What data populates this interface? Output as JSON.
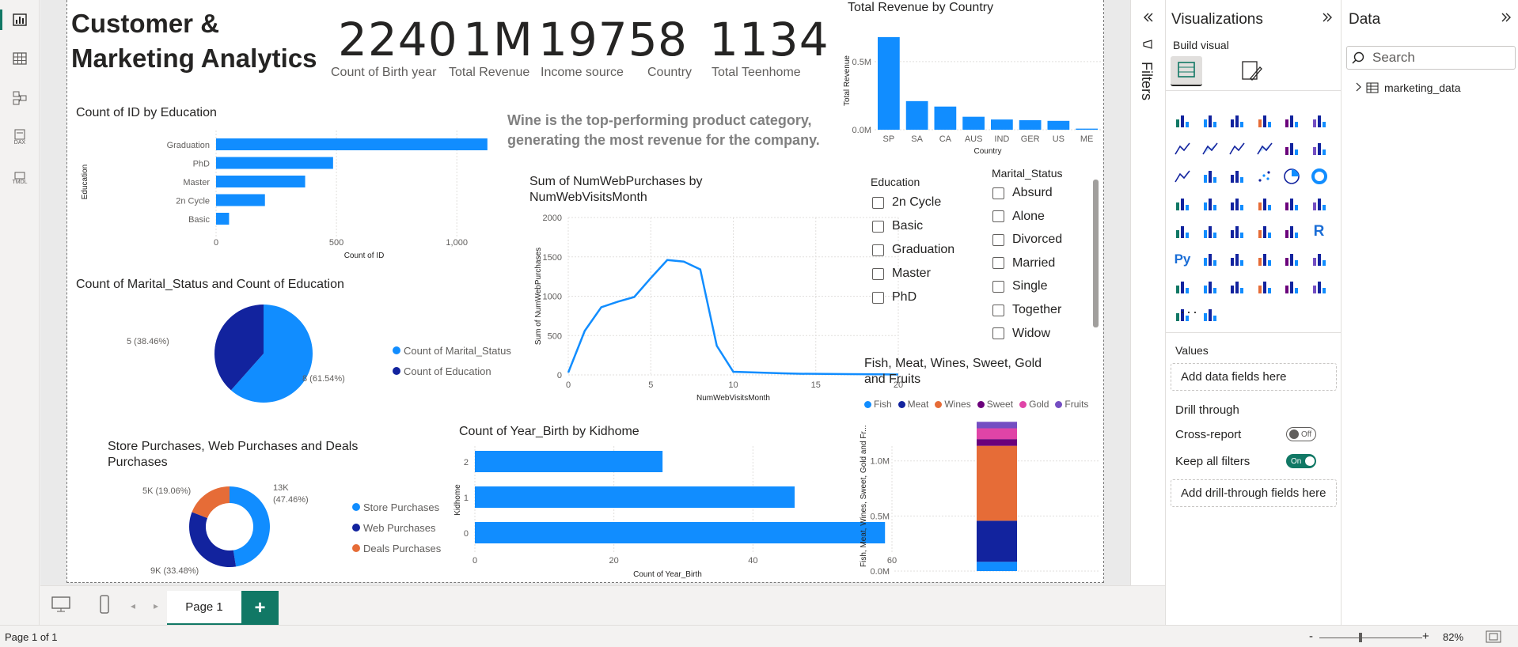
{
  "rail": {
    "items": [
      "report-view",
      "table-view",
      "model-view",
      "dax-query-view",
      "tmdl-view"
    ],
    "dax_label": "DAX",
    "tmdl_label": "TMDL"
  },
  "report": {
    "title_line1": "Customer &",
    "title_line2": "Marketing Analytics",
    "kpis": [
      {
        "value": "2240",
        "label": "Count of Birth year"
      },
      {
        "value": "1M",
        "label": "Total Revenue"
      },
      {
        "value": "1975",
        "label": "Income source"
      },
      {
        "value": "8",
        "label": "Country"
      },
      {
        "value": "1134",
        "label": "Total Teenhome"
      }
    ],
    "insight_line1": "Wine is the top-performing product category,",
    "insight_line2": "generating the most revenue for the company."
  },
  "colors": {
    "blue": "#118dff",
    "navy": "#12239e",
    "orange": "#e66c37",
    "purple": "#6b007b",
    "pink": "#e044a7",
    "violet": "#744ec2",
    "accent": "#117865"
  },
  "chart_data": [
    {
      "id": "revenue-by-country",
      "type": "bar",
      "title": "Total Revenue by Country",
      "xlabel": "Country",
      "ylabel": "Total Revenue",
      "categories": [
        "SP",
        "SA",
        "CA",
        "AUS",
        "IND",
        "GER",
        "US",
        "ME"
      ],
      "values": [
        680000,
        210000,
        170000,
        95000,
        75000,
        70000,
        65000,
        8000
      ],
      "yticks": [
        "0.0M",
        "0.5M"
      ],
      "ylim": [
        0,
        720000
      ]
    },
    {
      "id": "id-by-education",
      "type": "bar",
      "orientation": "horizontal",
      "title": "Count of ID by Education",
      "xlabel": "Count of ID",
      "ylabel": "Education",
      "categories": [
        "Graduation",
        "PhD",
        "Master",
        "2n Cycle",
        "Basic"
      ],
      "values": [
        1127,
        486,
        370,
        203,
        54
      ],
      "xticks": [
        "0",
        "500",
        "1,000"
      ],
      "xlim": [
        0,
        1200
      ]
    },
    {
      "id": "marital-education-pie",
      "type": "pie",
      "title": "Count of Marital_Status and Count of Education",
      "series": [
        {
          "name": "Count of Marital_Status",
          "value": 8,
          "label": "8 (61.54%)"
        },
        {
          "name": "Count of Education",
          "value": 5,
          "label": "5 (38.46%)"
        }
      ]
    },
    {
      "id": "purchases-donut",
      "type": "pie",
      "title": "Store Purchases, Web Purchases and Deals Purchases",
      "series": [
        {
          "name": "Store Purchases",
          "value": 47.46,
          "label_a": "13K",
          "label_b": "(47.46%)"
        },
        {
          "name": "Web Purchases",
          "value": 33.48,
          "label": "9K (33.48%)"
        },
        {
          "name": "Deals Purchases",
          "value": 19.06,
          "label": "5K (19.06%)"
        }
      ]
    },
    {
      "id": "web-purchases-line",
      "type": "line",
      "title_line1": "Sum of NumWebPurchases by",
      "title_line2": "NumWebVisitsMonth",
      "xlabel": "NumWebVisitsMonth",
      "ylabel": "Sum of NumWebPurchases",
      "x": [
        0,
        1,
        2,
        3,
        4,
        5,
        6,
        7,
        8,
        9,
        10,
        13,
        14,
        17,
        19,
        20
      ],
      "y": [
        30,
        560,
        860,
        930,
        990,
        1230,
        1460,
        1440,
        1340,
        370,
        40,
        20,
        15,
        10,
        8,
        5
      ],
      "xticks": [
        "0",
        "5",
        "10",
        "15",
        "20"
      ],
      "yticks": [
        "0",
        "500",
        "1000",
        "1500",
        "2000"
      ],
      "xlim": [
        0,
        20
      ],
      "ylim": [
        0,
        2000
      ]
    },
    {
      "id": "yearbirth-by-kidhome",
      "type": "bar",
      "orientation": "horizontal",
      "title": "Count of Year_Birth by Kidhome",
      "xlabel": "Count of Year_Birth",
      "ylabel": "Kidhome",
      "categories": [
        "2",
        "1",
        "0"
      ],
      "values": [
        27,
        46,
        59
      ],
      "xticks": [
        "0",
        "20",
        "40",
        "60"
      ],
      "xlim": [
        0,
        60
      ]
    },
    {
      "id": "product-stacked",
      "type": "bar",
      "stacked": true,
      "title_line1": "Fish, Meat, Wines, Sweet, Gold",
      "title_line2": "and Fruits",
      "ylabel": "Fish, Meat, Wines, Sweet, Gold and Fr...",
      "yticks": [
        "0.0M",
        "0.5M",
        "1.0M"
      ],
      "ylim": [
        0,
        1350000
      ],
      "series": [
        {
          "name": "Fish",
          "value": 84000
        },
        {
          "name": "Meat",
          "value": 373000
        },
        {
          "name": "Wines",
          "value": 680000
        },
        {
          "name": "Sweet",
          "value": 61000
        },
        {
          "name": "Gold",
          "value": 98000
        },
        {
          "name": "Fruits",
          "value": 59000
        }
      ]
    }
  ],
  "slicers": {
    "education": {
      "title": "Education",
      "items": [
        "2n Cycle",
        "Basic",
        "Graduation",
        "Master",
        "PhD"
      ]
    },
    "marital": {
      "title": "Marital_Status",
      "items": [
        "Absurd",
        "Alone",
        "Divorced",
        "Married",
        "Single",
        "Together",
        "Widow"
      ]
    }
  },
  "filters": {
    "label": "Filters"
  },
  "viz": {
    "title": "Visualizations",
    "build_visual": "Build visual",
    "more": "···",
    "values_label": "Values",
    "values_placeholder": "Add data fields here",
    "drill_through": "Drill through",
    "cross_report": "Cross-report",
    "cross_report_state": "Off",
    "keep_filters": "Keep all filters",
    "keep_filters_state": "On",
    "drill_placeholder": "Add drill-through fields here"
  },
  "data": {
    "title": "Data",
    "search_placeholder": "Search",
    "table_name": "marketing_data"
  },
  "tabs": {
    "page_label": "Page 1",
    "add": "+"
  },
  "status": {
    "page_info": "Page 1 of 1",
    "zoom": "82%",
    "minus": "-",
    "plus": "+"
  }
}
